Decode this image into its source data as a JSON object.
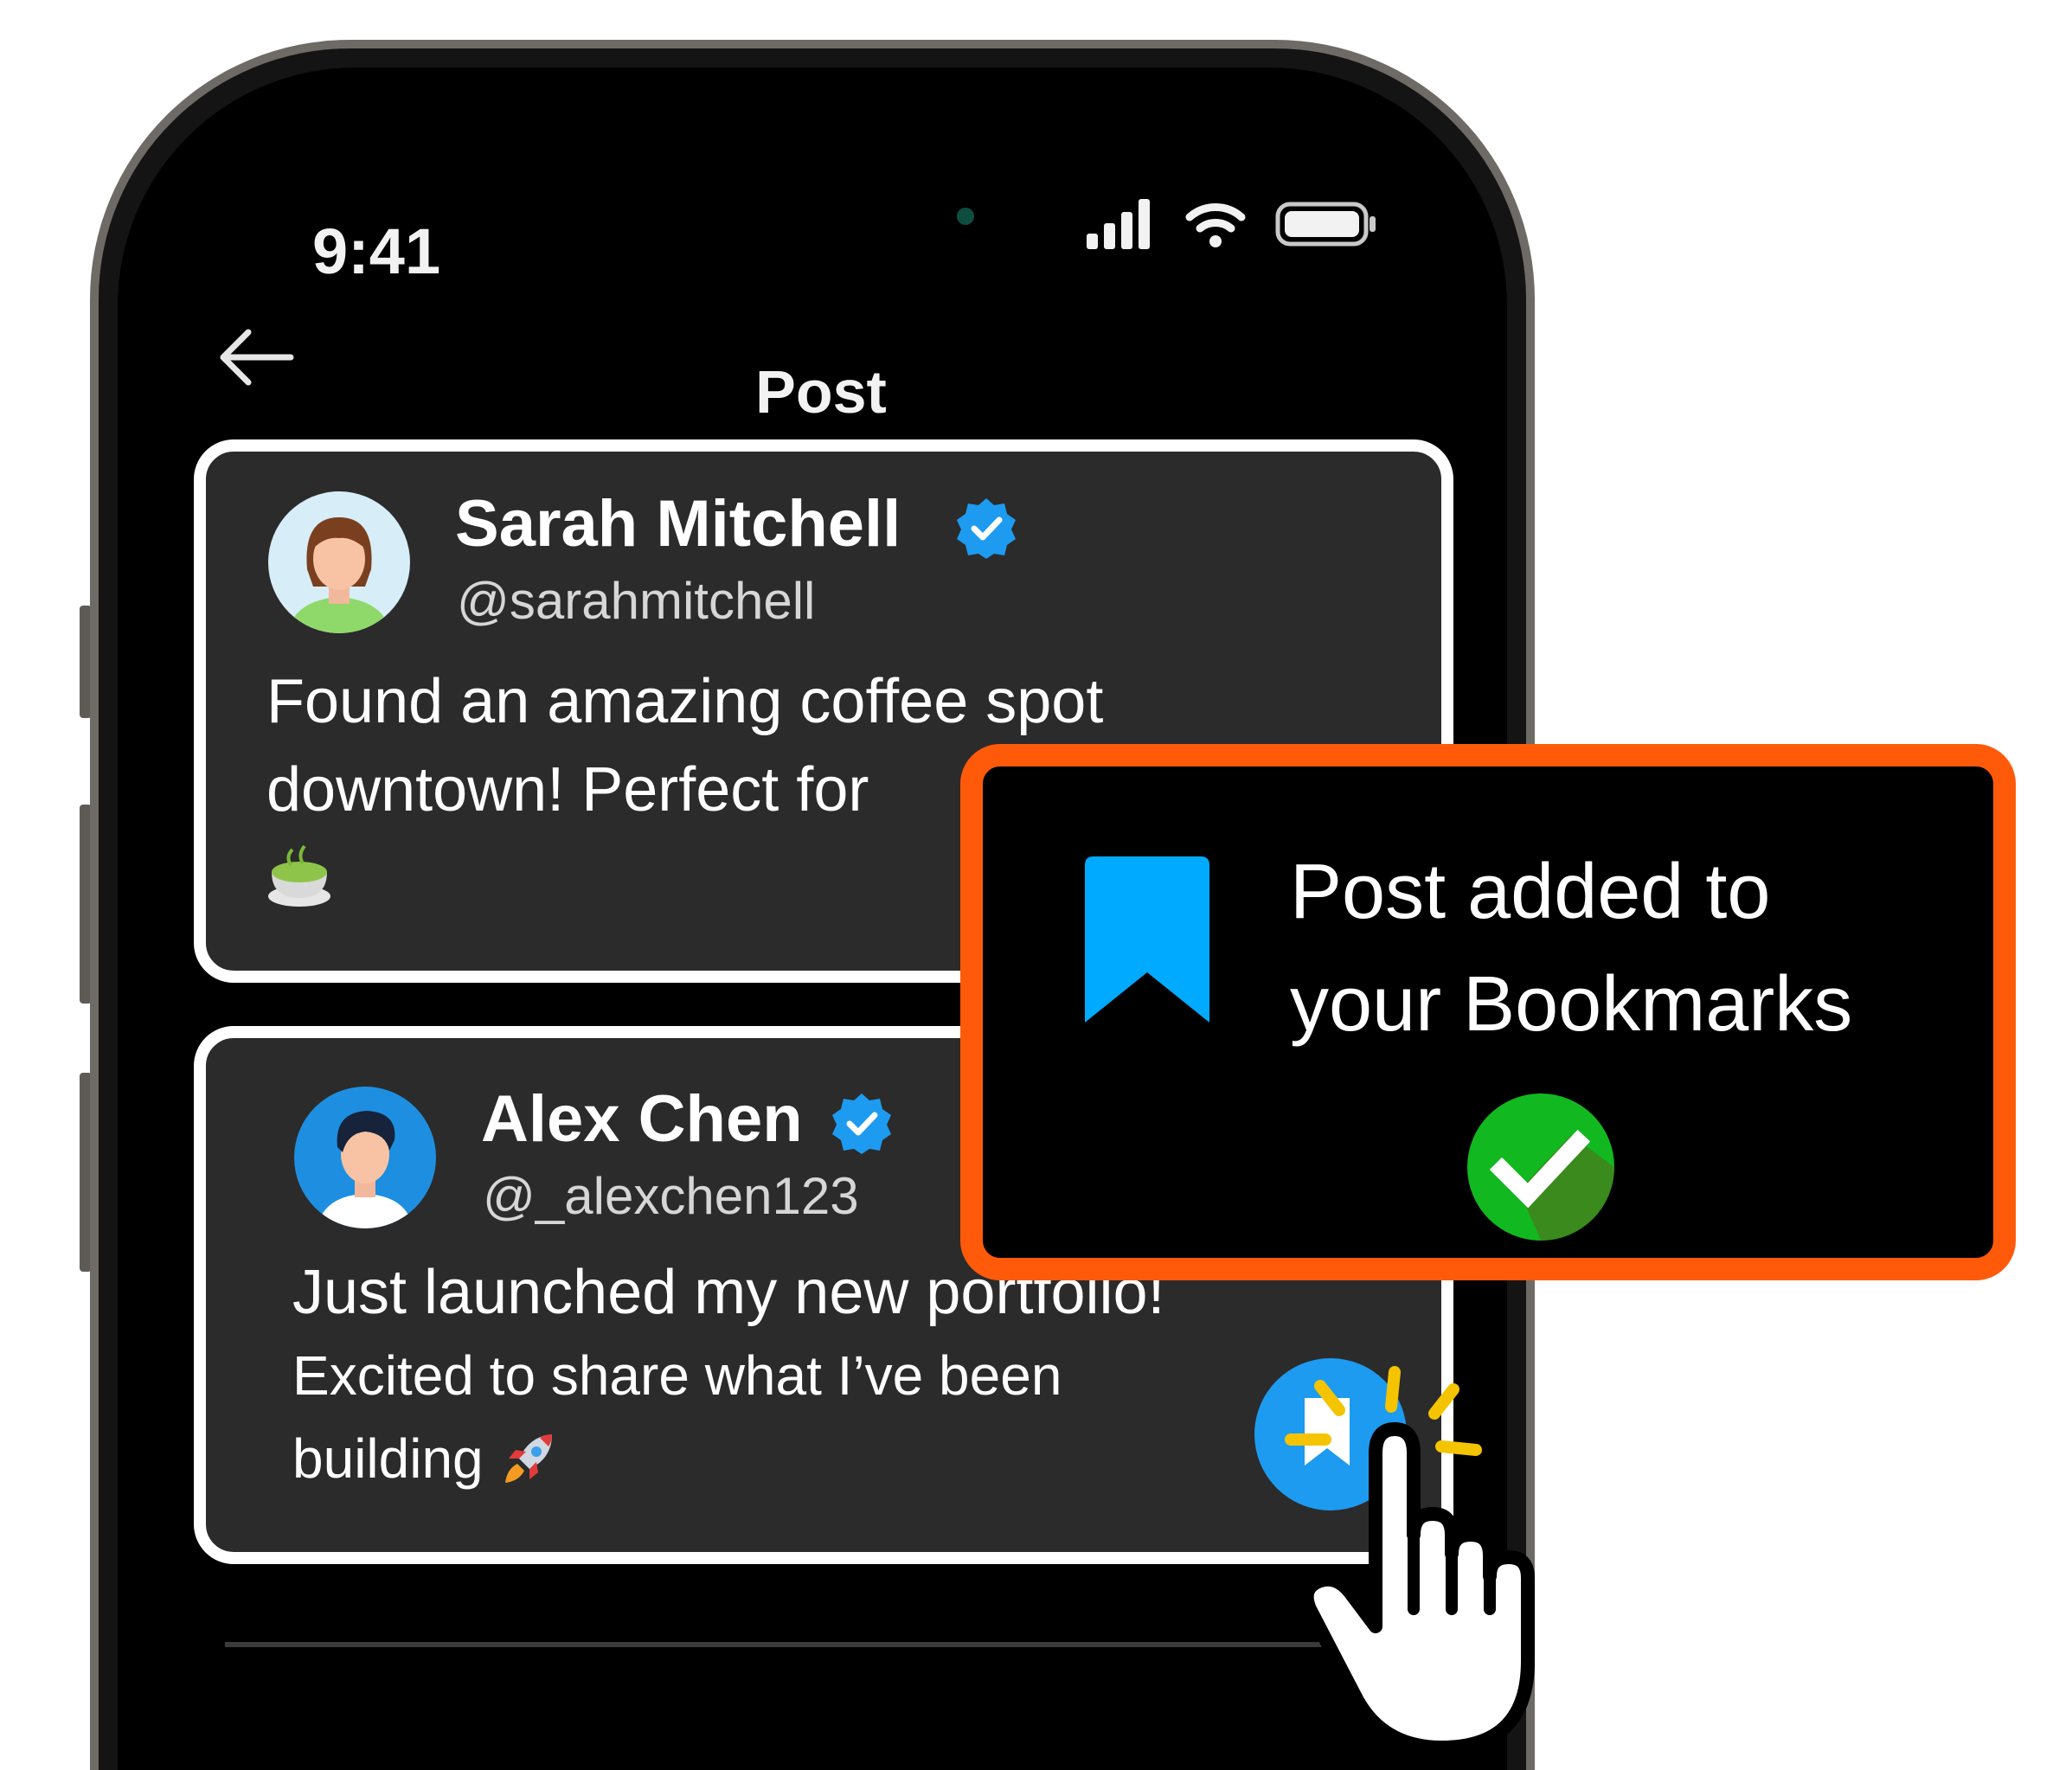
{
  "status_bar": {
    "time": "9:41"
  },
  "nav": {
    "title": "Post"
  },
  "posts": [
    {
      "author": "Sarah Mitchell",
      "handle": "@sarahmitchell",
      "lines": [
        "Found an amazing coffee spot",
        "downtown! Perfect for"
      ]
    },
    {
      "author": "Alex Chen",
      "handle": "@_alexchen123",
      "lines": [
        "Just launched my new portfolio!",
        "Excited to share what I’ve been",
        "building"
      ]
    }
  ],
  "toast": {
    "line1": "Post added to",
    "line2": "your Bookmarks"
  },
  "colors": {
    "accent_orange": "#ff5a0a",
    "bookmark_blue": "#00aaff",
    "verified_blue": "#1d9bf0",
    "success_green": "#12b81f"
  },
  "icons": [
    "back-arrow-icon",
    "verified-icon",
    "signal-icon",
    "wifi-icon",
    "battery-icon",
    "bookmark-icon",
    "checkmark-icon",
    "pointing-hand-icon",
    "tea-emoji-icon",
    "rocket-emoji-icon"
  ]
}
